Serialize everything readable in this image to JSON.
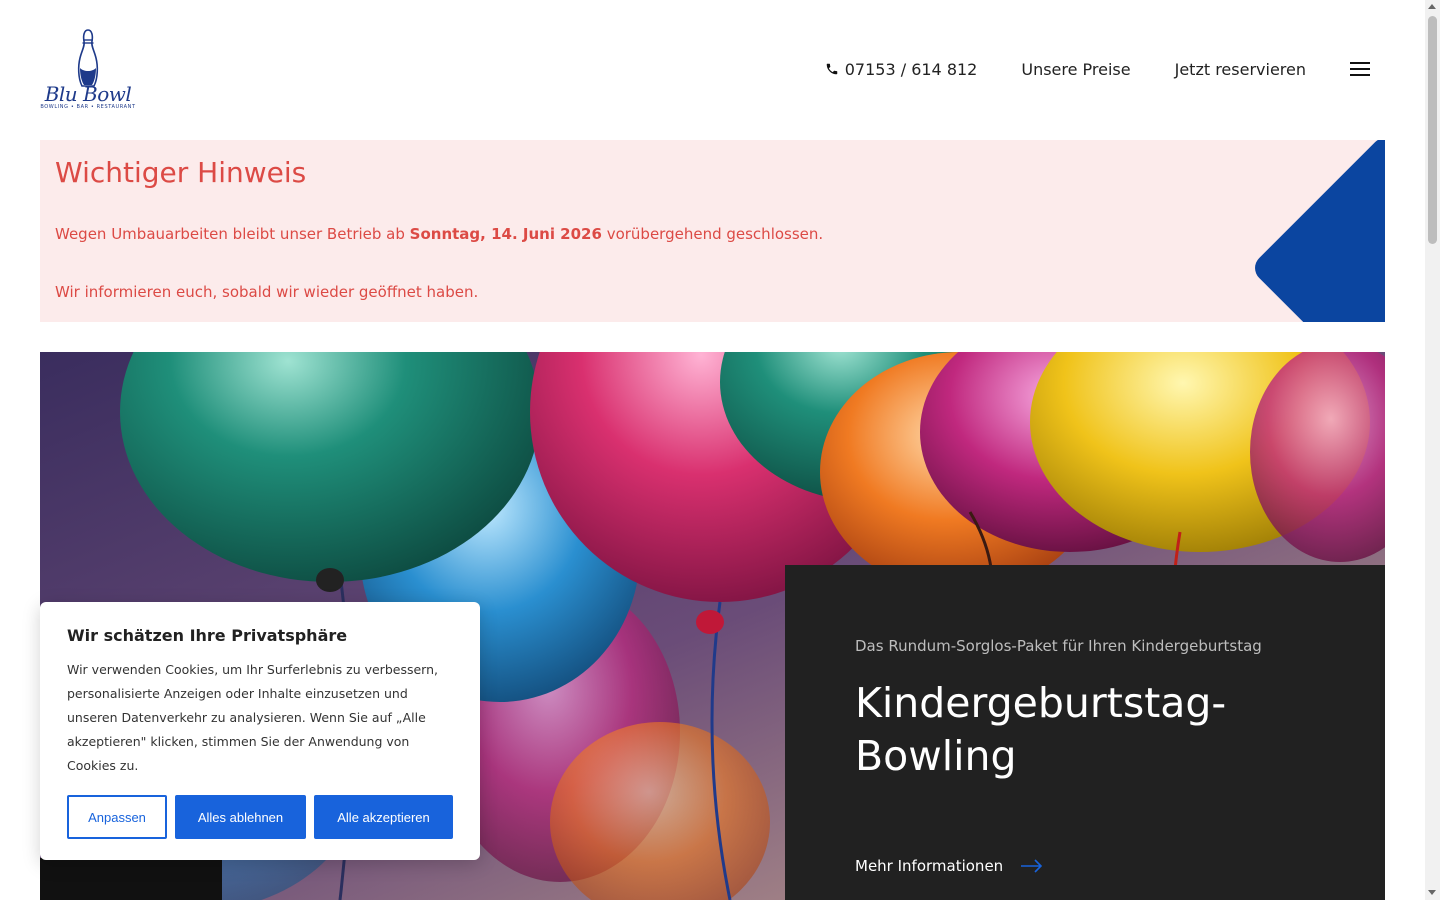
{
  "brand": {
    "logo_name": "Blu Bowl",
    "logo_tagline": "BOWLING • BAR • RESTAURANT",
    "color": "#1e3a8a"
  },
  "nav": {
    "phone_icon": "phone-icon",
    "phone": "07153 / 614 812",
    "prices": "Unsere Preise",
    "reserve": "Jetzt reservieren",
    "menu_icon": "hamburger-menu-icon"
  },
  "notice": {
    "title": "Wichtiger Hinweis",
    "line1_before": "Wegen Umbauarbeiten bleibt unser Betrieb ab ",
    "line1_bold": "Sonntag, 14. Juni 2026",
    "line1_after": " vorübergehend geschlossen.",
    "line2": "Wir informieren euch, sobald wir wieder geöffnet haben.",
    "text_color": "#dc4a45",
    "background": "#fcebeb",
    "accent": "#0b45a0"
  },
  "promo": {
    "subtitle": "Das Rundum-Sorglos-Paket für Ihren Kindergeburtstag",
    "title": "Kindergeburtstag-Bowling",
    "link": "Mehr Informationen",
    "link_icon": "arrow-right-icon",
    "background": "#212121"
  },
  "cookie": {
    "title": "Wir schätzen Ihre Privatsphäre",
    "text": "Wir verwenden Cookies, um Ihr Surferlebnis zu verbessern, personalisierte Anzeigen oder Inhalte einzusetzen und unseren Datenverkehr zu analysieren. Wenn Sie auf „Alle akzeptieren\" klicken, stimmen Sie der Anwendung von Cookies zu.",
    "customize": "Anpassen",
    "reject": "Alles ablehnen",
    "accept": "Alle akzeptieren",
    "button_color": "#1863dc"
  }
}
